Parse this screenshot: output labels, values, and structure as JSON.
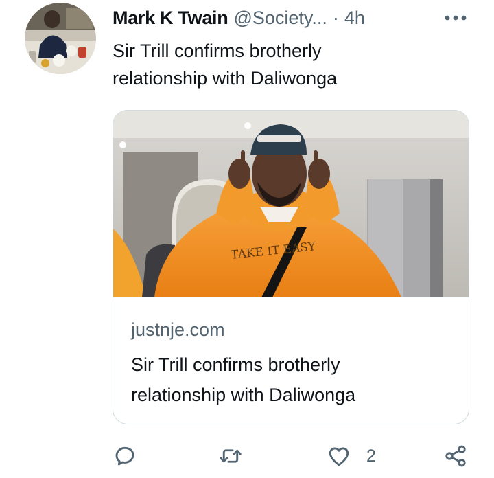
{
  "tweet": {
    "author": {
      "display_name": "Mark K Twain",
      "handle": "@Society...",
      "separator": "·",
      "timestamp": "4h"
    },
    "text_line1": "Sir Trill confirms brotherly",
    "text_line2": "relationship with Daliwonga",
    "card": {
      "domain": "justnje.com",
      "title_line1": "Sir Trill confirms brotherly",
      "title_line2": "relationship with Daliwonga",
      "hoodie_print": "TAKE IT EASY"
    },
    "actions": {
      "reply_icon": "reply-icon",
      "retweet_icon": "retweet-icon",
      "like_icon": "heart-icon",
      "like_count": "2",
      "share_icon": "share-icon"
    }
  },
  "colors": {
    "primary_text": "#0f1419",
    "secondary_text": "#536471",
    "border": "#cfd9de",
    "hoodie_orange": "#f28a1c"
  }
}
